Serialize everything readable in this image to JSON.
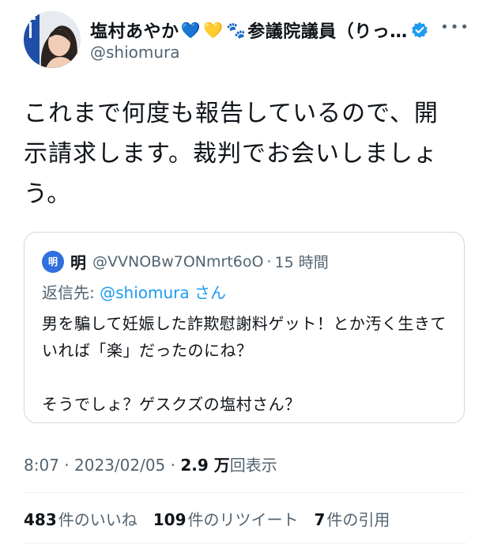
{
  "author": {
    "display_name": "塩村あやか",
    "name_emojis": [
      "💙",
      "💛",
      "🐾"
    ],
    "name_suffix": "参議院議員（りっ…",
    "handle": "@shiomura",
    "verified_icon": "verified-badge-icon",
    "more_icon": "more-icon"
  },
  "tweet": {
    "text": "これまで何度も報告しているので、開示請求します。裁判でお会いしましょう。"
  },
  "quoted": {
    "avatar_text": "明",
    "name": "明",
    "handle": "@VVNOBw7ONmrt6oO",
    "separator": "·",
    "time": "15 時間",
    "reply_label": "返信先: ",
    "reply_mention": "@shiomura",
    "reply_suffix": " さん",
    "body_lines": [
      "男を騙して妊娠した詐欺慰謝料ゲット！とか汚く生きていれば「楽」だったのにね？",
      "そうでしょ？ゲスクズの塩村さん？"
    ]
  },
  "meta": {
    "time": "8:07",
    "separator": "·",
    "date": "2023/02/05",
    "views_count": "2.9 万",
    "views_label": "回表示"
  },
  "stats": {
    "likes_count": "483",
    "likes_label": "件のいいね",
    "retweets_count": "109",
    "retweets_label": "件のリツイート",
    "quotes_count": "7",
    "quotes_label": "件の引用"
  },
  "colors": {
    "text": "#0f1419",
    "secondary": "#536471",
    "link": "#1d9bf0",
    "border": "#cfd9de"
  }
}
